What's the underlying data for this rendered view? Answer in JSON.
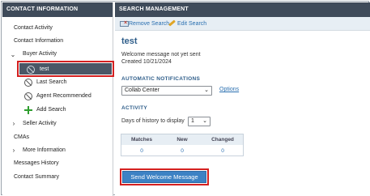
{
  "left_panel": {
    "header": "CONTACT INFORMATION",
    "items": [
      {
        "label": "Contact Activity"
      },
      {
        "label": "Contact Information"
      },
      {
        "label": "Buyer Activity"
      },
      {
        "label": "test"
      },
      {
        "label": "Last Search"
      },
      {
        "label": "Agent Recommended"
      },
      {
        "label": "Add Search"
      },
      {
        "label": "Seller Activity"
      },
      {
        "label": "CMAs"
      },
      {
        "label": "More Information"
      },
      {
        "label": "Messages History"
      },
      {
        "label": "Contact Summary"
      }
    ]
  },
  "right_panel": {
    "header": "SEARCH MANAGEMENT",
    "toolbar": {
      "remove_label": "Remove Search",
      "edit_label": "Edit Search"
    },
    "search_title": "test",
    "welcome_status": "Welcome message not yet sent",
    "created": "Created 10/21/2024",
    "notifications": {
      "section_label": "AUTOMATIC NOTIFICATIONS",
      "selected": "Collab Center",
      "options_link": "Options"
    },
    "activity": {
      "section_label": "ACTIVITY",
      "days_label": "Days of history to display",
      "days_selected": "1",
      "columns": [
        "Matches",
        "New",
        "Changed"
      ],
      "values": [
        "0",
        "0",
        "0"
      ]
    },
    "send_button": "Send Welcome Message"
  },
  "colors": {
    "header_bg": "#3f4b5a",
    "selected_bg": "#4a5766",
    "highlight_border": "#d42020",
    "link": "#2a6fb0",
    "title": "#2f5e8a",
    "button_bg": "#3d82c4"
  },
  "icons": [
    "chevron-down-icon",
    "chevron-right-icon",
    "no-entry-icon",
    "add-icon",
    "remove-search-icon",
    "pencil-icon",
    "dropdown-arrow-icon"
  ]
}
